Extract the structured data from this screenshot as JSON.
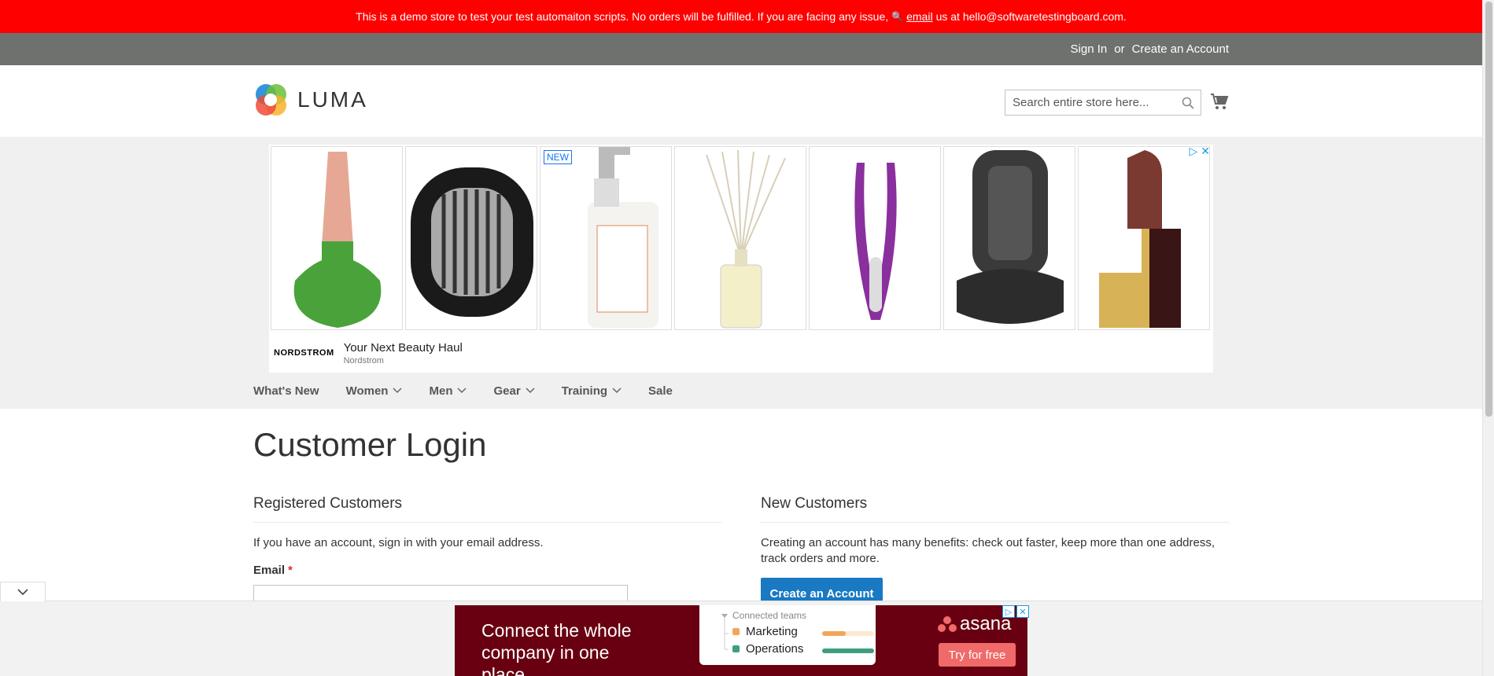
{
  "demo_banner": {
    "text_before": "This is a demo store to test your test automaiton scripts. No orders will be fulfilled. If you are facing any issue,",
    "link": "email",
    "text_after": "us at hello@softwaretestingboard.com."
  },
  "top_links": {
    "sign_in": "Sign In",
    "or": "or",
    "create_account": "Create an Account"
  },
  "header": {
    "logo_text": "LUMA",
    "search_placeholder": "Search entire store here..."
  },
  "ad": {
    "new_badge": "NEW",
    "brand": "NORDSTROM",
    "headline": "Your Next Beauty Haul",
    "source": "Nordstrom",
    "choices_icon": "ad-choices-icon",
    "close_icon": "close-icon"
  },
  "nav": {
    "items": [
      {
        "label": "What's New",
        "dropdown": false
      },
      {
        "label": "Women",
        "dropdown": true
      },
      {
        "label": "Men",
        "dropdown": true
      },
      {
        "label": "Gear",
        "dropdown": true
      },
      {
        "label": "Training",
        "dropdown": true
      },
      {
        "label": "Sale",
        "dropdown": false
      }
    ]
  },
  "page": {
    "title": "Customer Login"
  },
  "registered": {
    "title": "Registered Customers",
    "intro": "If you have an account, sign in with your email address.",
    "email_label": "Email",
    "required_mark": "*",
    "email_value": ""
  },
  "new_customers": {
    "title": "New Customers",
    "intro": "Creating an account has many benefits: check out faster, keep more than one address, track orders and more.",
    "button": "Create an Account"
  },
  "bottom_ad": {
    "headline": "Connect the whole company in one place",
    "card_title": "Connected teams",
    "rows": [
      {
        "label": "Marketing",
        "color": "#f1a65b",
        "progress": 0.45
      },
      {
        "label": "Operations",
        "color": "#3f9e7f",
        "progress": 1.0
      }
    ],
    "brand": "asana",
    "cta": "Try for free"
  },
  "colors": {
    "banner_red": "#ff0000",
    "top_bar": "#6e716e",
    "primary_button": "#1979c3",
    "asana_bg": "#690011"
  }
}
